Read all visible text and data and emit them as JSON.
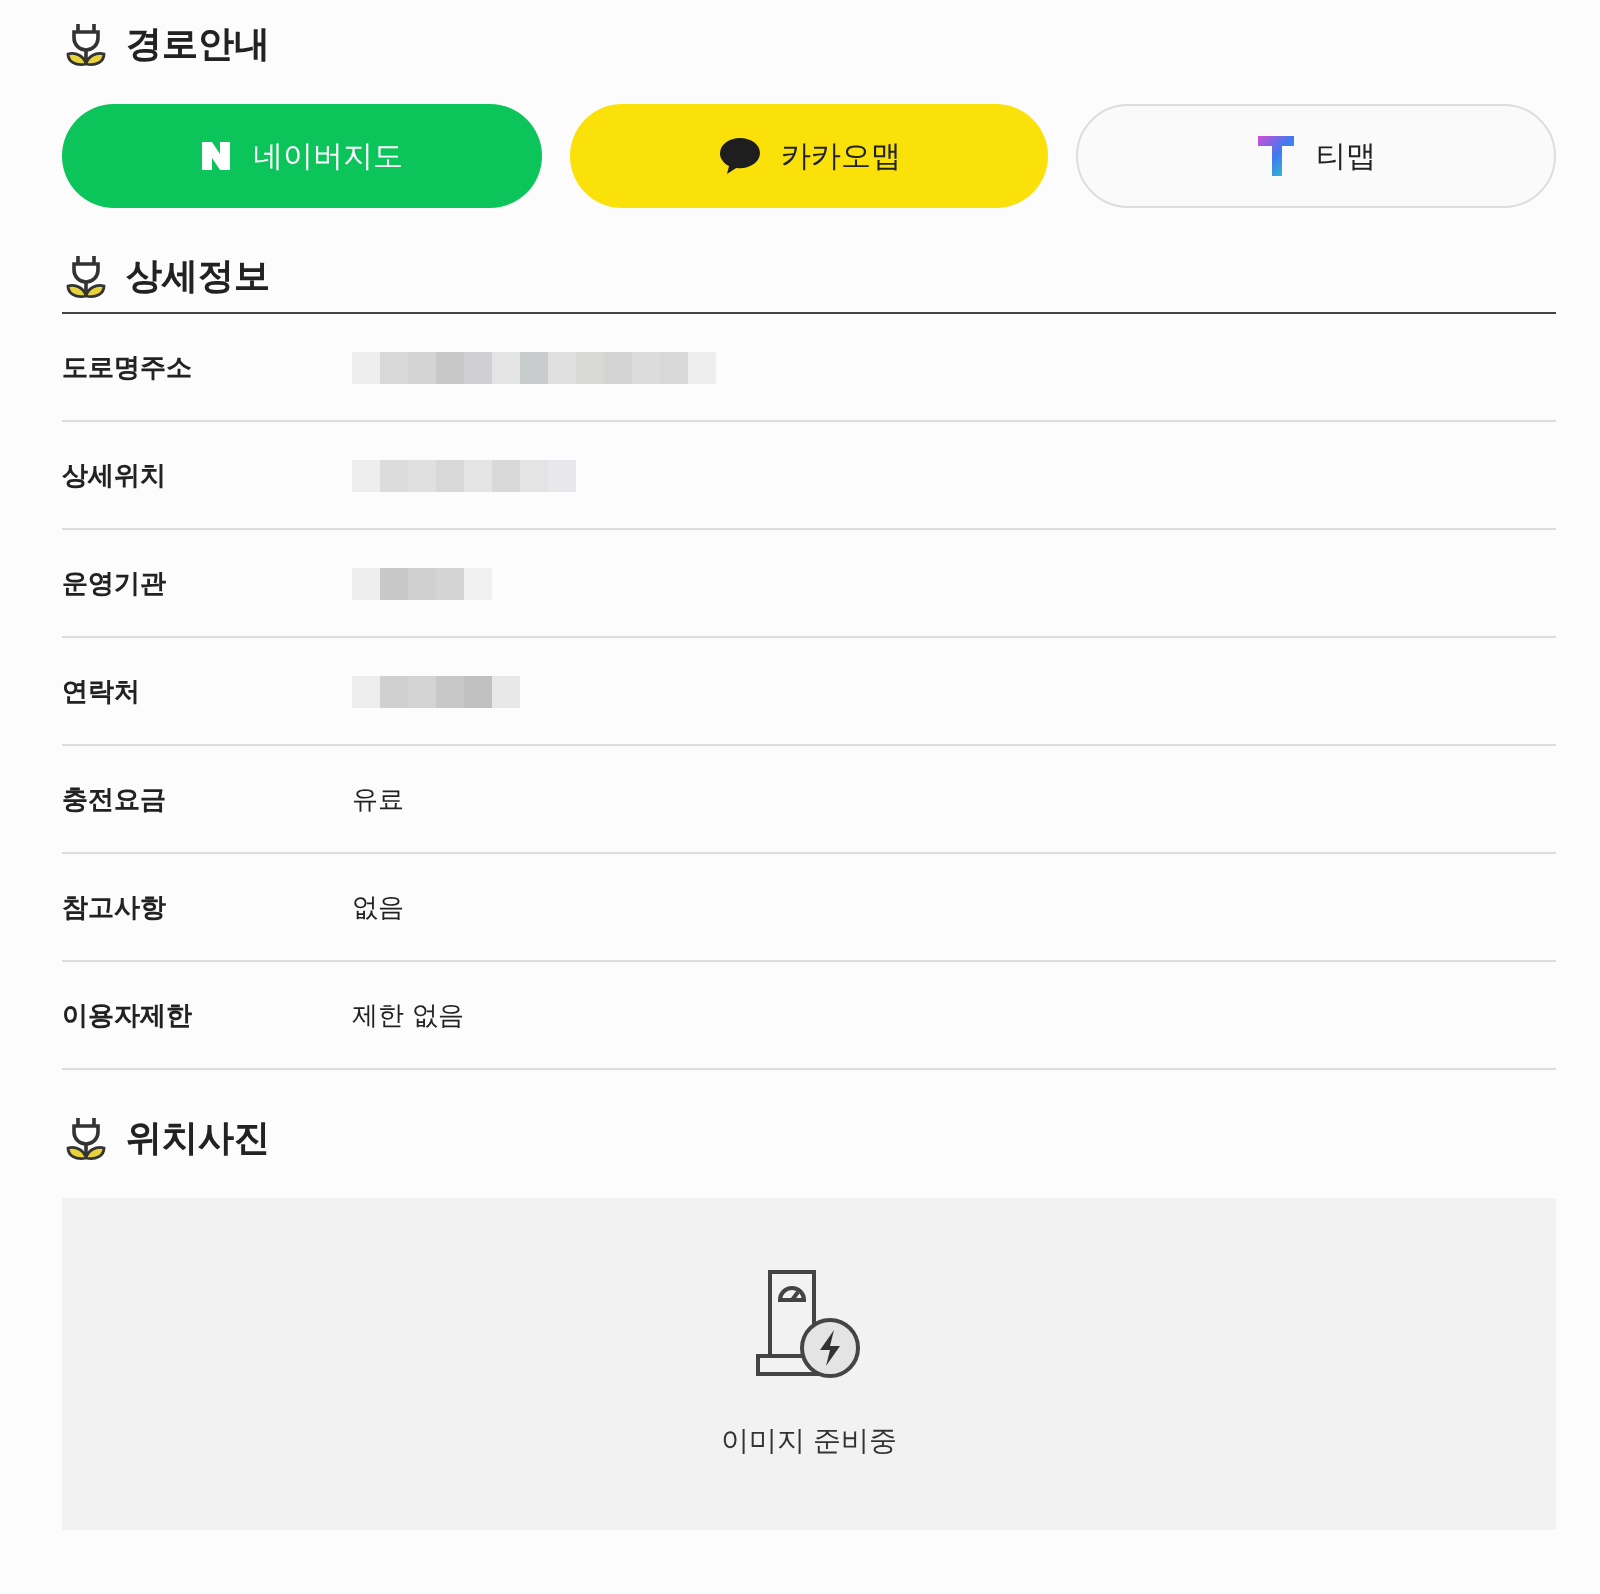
{
  "route_section": {
    "title": "경로안내"
  },
  "map_buttons": [
    {
      "kind": "naver",
      "label": "네이버지도"
    },
    {
      "kind": "kakao",
      "label": "카카오맵"
    },
    {
      "kind": "tmap",
      "label": "티맵"
    }
  ],
  "detail_section": {
    "title": "상세정보"
  },
  "details": [
    {
      "label": "도로명주소",
      "kind": "redacted"
    },
    {
      "label": "상세위치",
      "kind": "redacted"
    },
    {
      "label": "운영기관",
      "kind": "redacted"
    },
    {
      "label": "연락처",
      "kind": "redacted"
    },
    {
      "label": "충전요금",
      "kind": "text",
      "value": "유료"
    },
    {
      "label": "참고사항",
      "kind": "text",
      "value": "없음"
    },
    {
      "label": "이용자제한",
      "kind": "text",
      "value": "제한 없음"
    }
  ],
  "photo_section": {
    "title": "위치사진",
    "placeholder_text": "이미지 준비중"
  }
}
